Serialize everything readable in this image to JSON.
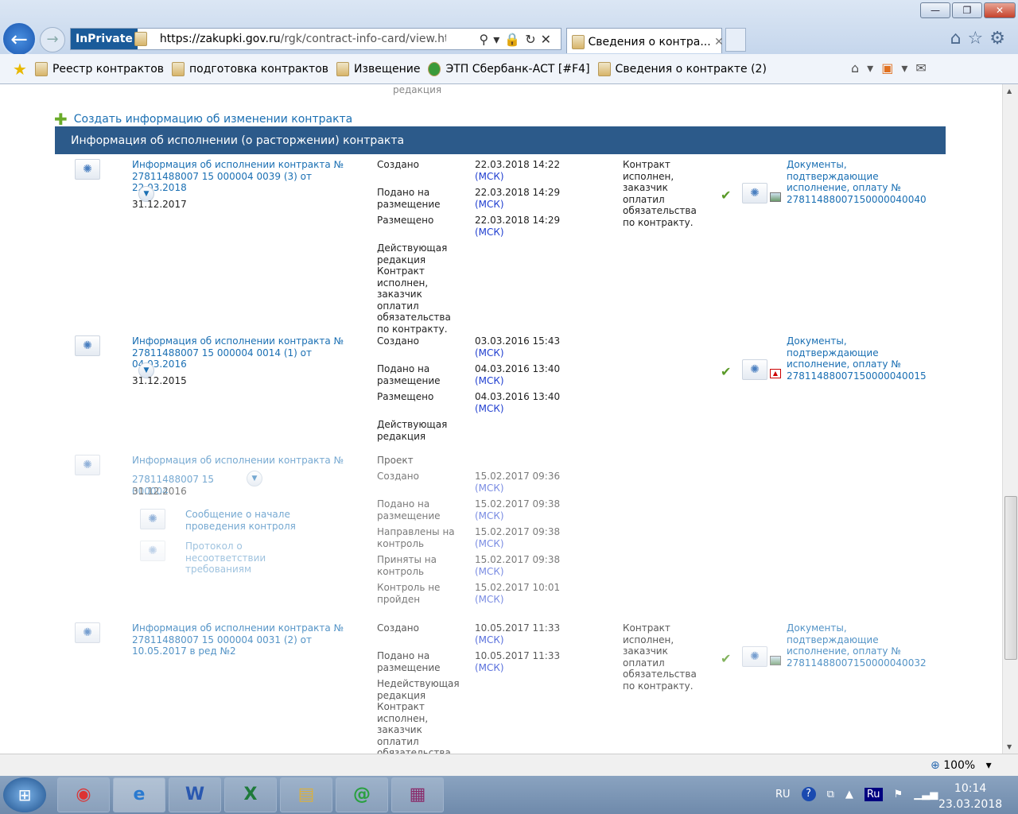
{
  "browser": {
    "inprivate": "InPrivate",
    "url_host": "https://zakupki.gov.ru",
    "url_path": "/rgk/contract-info-card/view.html?cc",
    "tab_title": "Сведения о контра...",
    "zoom": "100%",
    "favorites": [
      "Реестр контрактов",
      "подготовка контрактов",
      "Извещение",
      "ЭТП Сбербанк-АСТ [#F4]",
      "Сведения о контракте (2)"
    ]
  },
  "page": {
    "cut_text": "редакция",
    "create_link": "Создать информацию об изменении контракта",
    "section_title": "Информация об исполнении (о расторжении) контракта"
  },
  "records": [
    {
      "title": "Информация об исполнении контракта № 27811488007 15 000004 0039 (3) от 22.03.2018",
      "date": "31.12.2017",
      "events": [
        {
          "label": "Создано",
          "value": "22.03.2018 14:22",
          "tz": "(МСК)"
        },
        {
          "label": "Подано на размещение",
          "value": "22.03.2018 14:29",
          "tz": "(МСК)"
        },
        {
          "label": "Размещено",
          "value": "22.03.2018 14:29",
          "tz": "(МСК)"
        },
        {
          "label": "Действующая редакция Контракт исполнен, заказчик оплатил обязательства по контракту.",
          "value": "",
          "tz": ""
        }
      ],
      "status": "Контракт исполнен, заказчик оплатил обязательства по контракту.",
      "doc_link": "Документы, подтверждающие исполнение, оплату № 27811488007150000040040"
    },
    {
      "title": "Информация об исполнении контракта № 27811488007 15 000004 0014 (1) от 04.03.2016",
      "date": "31.12.2015",
      "events": [
        {
          "label": "Создано",
          "value": "03.03.2016 15:43",
          "tz": "(МСК)"
        },
        {
          "label": "Подано на размещение",
          "value": "04.03.2016 13:40",
          "tz": "(МСК)"
        },
        {
          "label": "Размещено",
          "value": "04.03.2016 13:40",
          "tz": "(МСК)"
        },
        {
          "label": "Действующая редакция",
          "value": "",
          "tz": ""
        }
      ],
      "status": "",
      "doc_link": "Документы, подтверждающие исполнение, оплату № 27811488007150000040015"
    },
    {
      "title": "Информация об исполнении контракта №",
      "title2": "27811488007 15 000004",
      "date": "31.12.2016",
      "pre": "Проект",
      "sub1": "Сообщение о начале проведения контроля",
      "sub2": "Протокол о несоответствии требованиям",
      "events": [
        {
          "label": "Создано",
          "value": "15.02.2017 09:36",
          "tz": "(МСК)"
        },
        {
          "label": "Подано на размещение",
          "value": "15.02.2017 09:38",
          "tz": "(МСК)"
        },
        {
          "label": "Направлены на контроль",
          "value": "15.02.2017 09:38",
          "tz": "(МСК)"
        },
        {
          "label": "Приняты на контроль",
          "value": "15.02.2017 09:38",
          "tz": "(МСК)"
        },
        {
          "label": "Контроль не пройден",
          "value": "15.02.2017 10:01",
          "tz": "(МСК)"
        }
      ]
    },
    {
      "title": "Информация об исполнении контракта № 27811488007 15 000004 0031 (2) от 10.05.2017 в ред №2",
      "events": [
        {
          "label": "Создано",
          "value": "10.05.2017 11:33",
          "tz": "(МСК)"
        },
        {
          "label": "Подано на размещение",
          "value": "10.05.2017 11:33",
          "tz": "(МСК)"
        },
        {
          "label": "Недействующая редакция Контракт исполнен, заказчик оплатил обязательства по контракту.",
          "value": "",
          "tz": ""
        }
      ],
      "status": "Контракт исполнен, заказчик оплатил обязательства по контракту.",
      "doc_link": "Документы, подтверждающие исполнение, оплату № 27811488007150000040032"
    }
  ],
  "taskbar": {
    "lang": "RU",
    "lang_box": "Ru",
    "time": "10:14",
    "date": "23.03.2018"
  }
}
